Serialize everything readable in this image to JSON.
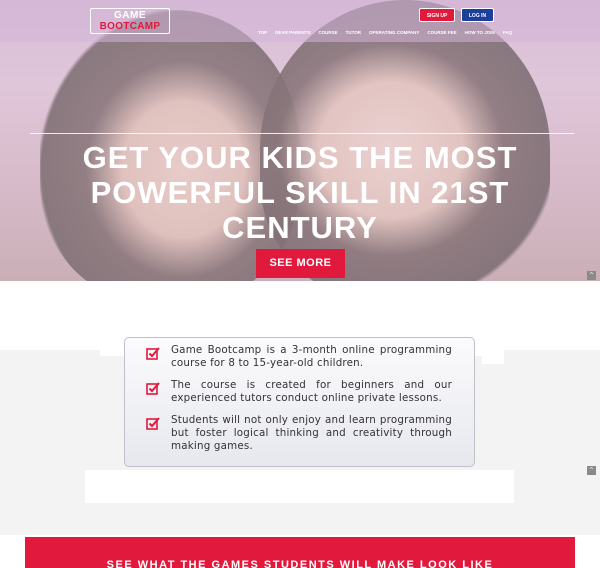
{
  "header": {
    "logo_line1": "GAME",
    "logo_line2": "BOOTCAMP",
    "signup_label": "SIGN UP",
    "login_label": "LOG IN",
    "nav": [
      "TOP",
      "DEAR PARENTS",
      "COURSE",
      "TUTOR",
      "OPERATING COMPANY",
      "COURSE FEE",
      "HOW TO JOIN",
      "FAQ"
    ]
  },
  "hero": {
    "title": "GET YOUR KIDS THE MOST POWERFUL SKILL IN 21ST CENTURY",
    "cta_label": "SEE MORE"
  },
  "info": {
    "items": [
      "Game Bootcamp is a 3-month online programming course for 8 to 15-year-old children.",
      "The course is created for beginners and our experienced tutors conduct online private lessons.",
      "Students will not only enjoy and learn programming but foster logical thinking and creativity through making games."
    ]
  },
  "banner": {
    "text": "SEE WHAT THE GAMES STUDENTS WILL MAKE LOOK LIKE"
  },
  "icons": {
    "scroll_top": "scroll-up-icon",
    "check": "checkbox-checked-icon"
  },
  "colors": {
    "accent_red": "#e1193c",
    "login_blue": "#1d3f9c"
  }
}
